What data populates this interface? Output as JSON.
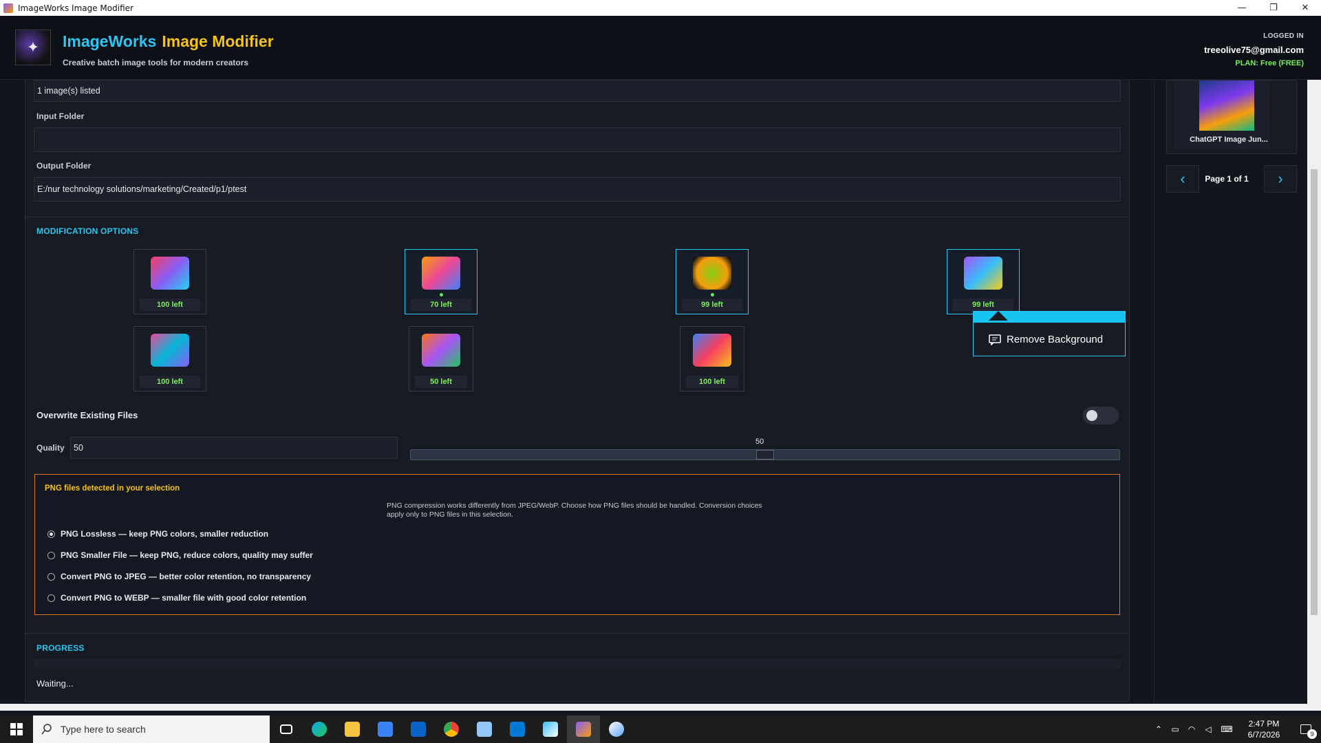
{
  "window": {
    "title": "ImageWorks Image Modifier",
    "minimize": "—",
    "restore": "❐",
    "close": "✕"
  },
  "header": {
    "brand_part1": "ImageWorks",
    "brand_part2": "Image Modifier",
    "tagline": "Creative batch image tools for modern creators",
    "logged_in_label": "LOGGED IN",
    "email": "treeolive75@gmail.com",
    "plan": "PLAN: Free (FREE)"
  },
  "files": {
    "count_text": "1 image(s) listed",
    "input_folder_label": "Input Folder",
    "input_folder_value": "",
    "output_folder_label": "Output Folder",
    "output_folder_value": "E:/nur technology solutions/marketing/Created/p1/ptest"
  },
  "modification": {
    "title": "MODIFICATION OPTIONS",
    "tools": [
      {
        "count": "100 left",
        "selected": false
      },
      {
        "count": "70 left",
        "selected": true
      },
      {
        "count": "99 left",
        "selected": true
      },
      {
        "count": "99 left",
        "selected": true
      },
      {
        "count": "100 left",
        "selected": false
      },
      {
        "count": "50 left",
        "selected": false
      },
      {
        "count": "100 left",
        "selected": false
      }
    ],
    "tooltip": "Remove Background"
  },
  "overwrite": {
    "label": "Overwrite Existing Files",
    "enabled": false
  },
  "quality": {
    "label": "Quality",
    "value": "50",
    "slider_label": "50",
    "slider_fraction": 0.5
  },
  "png": {
    "title": "PNG files detected in your selection",
    "description": "PNG compression works differently from JPEG/WebP. Choose how PNG files should be handled. Conversion choices apply only to PNG files in this selection.",
    "options": [
      {
        "label": "PNG Lossless — keep PNG colors, smaller reduction",
        "checked": true
      },
      {
        "label": "PNG Smaller File — keep PNG, reduce colors, quality may suffer",
        "checked": false
      },
      {
        "label": "Convert PNG to JPEG — better color retention, no transparency",
        "checked": false
      },
      {
        "label": "Convert PNG to WEBP — smaller file with good color retention",
        "checked": false
      }
    ]
  },
  "progress": {
    "title": "PROGRESS",
    "status": "Waiting..."
  },
  "sidebar": {
    "thumb_name": "ChatGPT Image Jun...",
    "prev": "‹",
    "next": "›",
    "page_text": "Page 1 of 1"
  },
  "taskbar": {
    "search_placeholder": "Type here to search",
    "time": "2:47 PM",
    "date": "6/7/2026",
    "notification_count": "9"
  },
  "colors": {
    "accent": "#2ec6f0",
    "brand_yellow": "#f6c21c",
    "success": "#7cf05c",
    "warning_border": "#e0742a"
  }
}
